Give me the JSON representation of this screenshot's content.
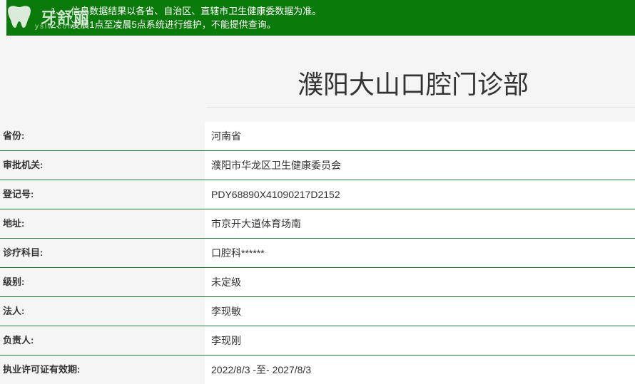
{
  "header": {
    "logo_text": "牙舒丽",
    "logo_sub": "yslw.com",
    "notices": [
      {
        "num": "1、",
        "text": "信息数据结果以各省、自治区、直辖市卫生健康委数据为准。"
      },
      {
        "num": "2、",
        "text": "凌晨1点至凌晨5点系统进行维护，不能提供查询。"
      }
    ],
    "banner_color": "#0a7a0a"
  },
  "title": "濮阳大山口腔门诊部",
  "rows": [
    {
      "label": "省份:",
      "value": "河南省"
    },
    {
      "label": "审批机关:",
      "value": "濮阳市华龙区卫生健康委员会"
    },
    {
      "label": "登记号:",
      "value": "PDY68890X41090217D2152"
    },
    {
      "label": "地址:",
      "value": "市京开大道体育场南"
    },
    {
      "label": "诊疗科目:",
      "value": "口腔科******"
    },
    {
      "label": "级别:",
      "value": "未定级"
    },
    {
      "label": "法人:",
      "value": "李现敏"
    },
    {
      "label": "负责人:",
      "value": "李现刚"
    },
    {
      "label": "执业许可证有效期:",
      "value": "2022/8/3 -至- 2027/8/3"
    }
  ]
}
